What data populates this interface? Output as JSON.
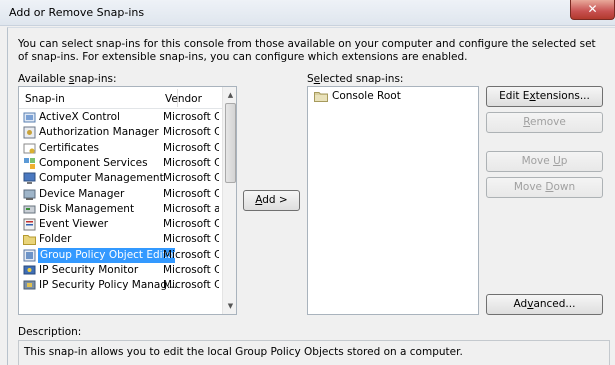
{
  "window": {
    "title": "Add or Remove Snap-ins",
    "close_glyph": "✕"
  },
  "intro_text": "You can select snap-ins for this console from those available on your computer and configure the selected set of snap-ins. For extensible snap-ins, you can configure which extensions are enabled.",
  "available": {
    "label_pre": "Available ",
    "label_access": "s",
    "label_post": "nap-ins:",
    "columns": {
      "snapin": "Snap-in",
      "vendor": "Vendor"
    },
    "items": [
      {
        "name": "ActiveX Control",
        "vendor": "Microsoft Cor",
        "icon": "activex-icon"
      },
      {
        "name": "Authorization Manager",
        "vendor": "Microsoft Cor",
        "icon": "authorization-icon"
      },
      {
        "name": "Certificates",
        "vendor": "Microsoft Cor",
        "icon": "certificates-icon"
      },
      {
        "name": "Component Services",
        "vendor": "Microsoft Cor",
        "icon": "component-services-icon"
      },
      {
        "name": "Computer Management",
        "vendor": "Microsoft Cor",
        "icon": "computer-management-icon"
      },
      {
        "name": "Device Manager",
        "vendor": "Microsoft Cor",
        "icon": "device-manager-icon"
      },
      {
        "name": "Disk Management",
        "vendor": "Microsoft and",
        "icon": "disk-management-icon"
      },
      {
        "name": "Event Viewer",
        "vendor": "Microsoft Cor",
        "icon": "event-viewer-icon"
      },
      {
        "name": "Folder",
        "vendor": "Microsoft Cor",
        "icon": "folder-icon"
      },
      {
        "name": "Group Policy Object Editor",
        "vendor": "Microsoft Cor",
        "icon": "group-policy-icon",
        "selected": true
      },
      {
        "name": "IP Security Monitor",
        "vendor": "Microsoft Cor",
        "icon": "ip-security-monitor-icon"
      },
      {
        "name": "IP Security Policy Manag...",
        "vendor": "Microsoft Cor",
        "icon": "ip-security-policy-icon"
      }
    ]
  },
  "add_button": {
    "label_access": "A",
    "label_rest": "dd >"
  },
  "selected": {
    "label_pre": "S",
    "label_access": "e",
    "label_post": "lected snap-ins:",
    "items": [
      {
        "name": "Console Root",
        "icon": "folder-icon"
      }
    ]
  },
  "buttons": {
    "edit_extensions": {
      "pre": "Edit E",
      "access": "x",
      "post": "tensions..."
    },
    "remove": {
      "pre": "",
      "access": "R",
      "post": "emove"
    },
    "move_up": {
      "pre": "Move ",
      "access": "U",
      "post": "p"
    },
    "move_down": {
      "pre": "Move ",
      "access": "D",
      "post": "own"
    },
    "advanced": {
      "pre": "Ad",
      "access": "v",
      "post": "anced..."
    }
  },
  "description": {
    "label": "Description:",
    "text": "This snap-in allows you to edit the local Group Policy Objects stored on a computer."
  },
  "colors": {
    "selection": "#3399ff",
    "window_bg": "#f0f0f0",
    "close_red": "#c75050"
  }
}
